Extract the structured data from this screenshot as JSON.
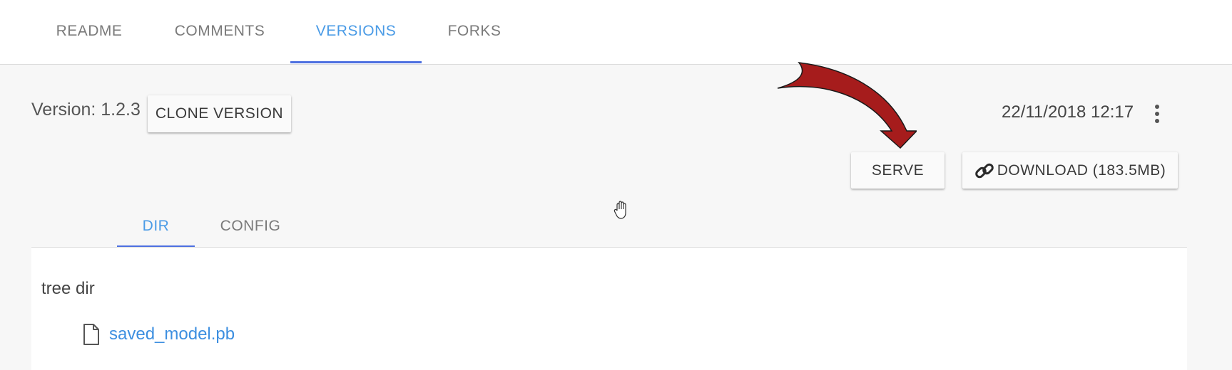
{
  "top_tabs": [
    {
      "label": "README"
    },
    {
      "label": "COMMENTS"
    },
    {
      "label": "VERSIONS"
    },
    {
      "label": "FORKS"
    }
  ],
  "active_top_tab": "VERSIONS",
  "version": {
    "label": "Version: 1.2.3",
    "clone_button": "CLONE VERSION",
    "timestamp": "22/11/2018 12:17",
    "more_icon": "more-vertical-icon"
  },
  "actions": {
    "serve_button": "SERVE",
    "download_button": "DOWNLOAD (183.5MB)",
    "download_icon": "link-icon"
  },
  "sub_tabs": [
    {
      "label": "DIR"
    },
    {
      "label": "CONFIG"
    }
  ],
  "active_sub_tab": "DIR",
  "tree": {
    "title": "tree dir",
    "files": [
      {
        "name": "saved_model.pb",
        "icon": "file-icon"
      }
    ]
  },
  "colors": {
    "accent": "#4a9be6",
    "tab_indicator": "#4d6fe0",
    "link": "#3d8fe0",
    "arrow_annotation": "#a61c1c"
  }
}
